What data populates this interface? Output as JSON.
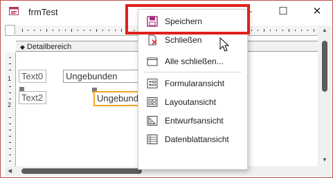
{
  "window": {
    "title": "frmTest",
    "minimize_glyph": "—",
    "maximize_glyph": "☐",
    "close_glyph": "✕"
  },
  "section": {
    "label": "Detailbereich"
  },
  "ruler_v": {
    "marks": [
      "1",
      "2"
    ]
  },
  "form": {
    "controls": [
      {
        "name": "label-text0",
        "text": "Text0"
      },
      {
        "name": "textbox-ungebunden-1",
        "text": "Ungebunden"
      },
      {
        "name": "label-text2",
        "text": "Text2"
      },
      {
        "name": "textbox-ungebunden-2",
        "text": "Ungebunden"
      }
    ]
  },
  "context_menu": {
    "items": [
      {
        "label": "Speichern",
        "icon": "save-icon"
      },
      {
        "label": "Schließen",
        "icon": "close-form-icon"
      },
      {
        "label": "Alle schließen...",
        "icon": "close-all-icon"
      },
      {
        "label": "Formularansicht",
        "icon": "form-view-icon"
      },
      {
        "label": "Layoutansicht",
        "icon": "layout-view-icon"
      },
      {
        "label": "Entwurfsansicht",
        "icon": "design-view-icon"
      },
      {
        "label": "Datenblattansicht",
        "icon": "datasheet-view-icon"
      }
    ]
  },
  "colors": {
    "highlight": "#e0201b",
    "selection": "#f5a623",
    "save_icon": "#a4287a"
  }
}
